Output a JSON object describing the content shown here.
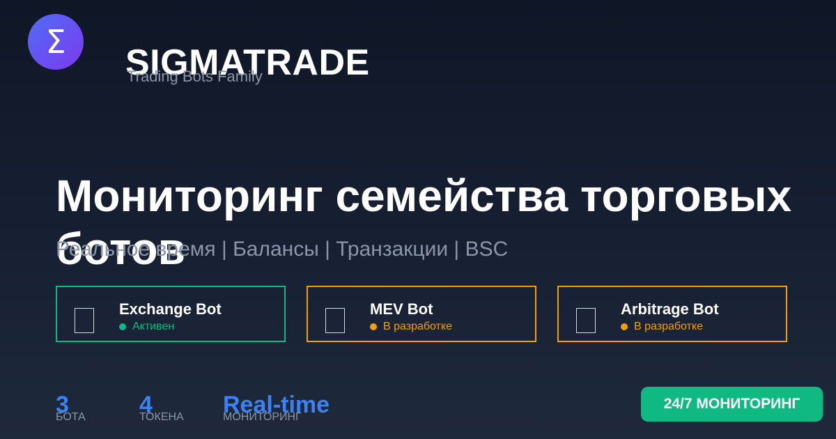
{
  "brand": {
    "logo_glyph": "Σ",
    "logo_icon": "sigma-icon",
    "name": "SIGMATRADE",
    "tagline": "Trading Bots Family"
  },
  "hero": {
    "title": "Мониторинг семейства торговых ботов",
    "subtitle": "Реальное время | Балансы | Транзакции | BSC"
  },
  "bots": [
    {
      "name": "Exchange Bot",
      "status": "Активен",
      "status_color": "#10b981",
      "icon": "bot-icon"
    },
    {
      "name": "MEV Bot",
      "status": "В разработке",
      "status_color": "#f59e0b",
      "icon": "bot-icon"
    },
    {
      "name": "Arbitrage Bot",
      "status": "В разработке",
      "status_color": "#f59e0b",
      "icon": "bot-icon"
    }
  ],
  "stats": [
    {
      "value": "3",
      "label": "БОТА"
    },
    {
      "value": "4",
      "label": "ТОКЕНА"
    },
    {
      "value": "Real-time",
      "label": "МОНИТОРИНГ"
    }
  ],
  "badge": {
    "label": "24/7 МОНИТОРИНГ"
  },
  "colors": {
    "accent_blue": "#3b82f6",
    "active_green": "#10b981",
    "warning_orange": "#f59e0b",
    "muted_text": "#8b96aa",
    "background": "#0f1626"
  }
}
